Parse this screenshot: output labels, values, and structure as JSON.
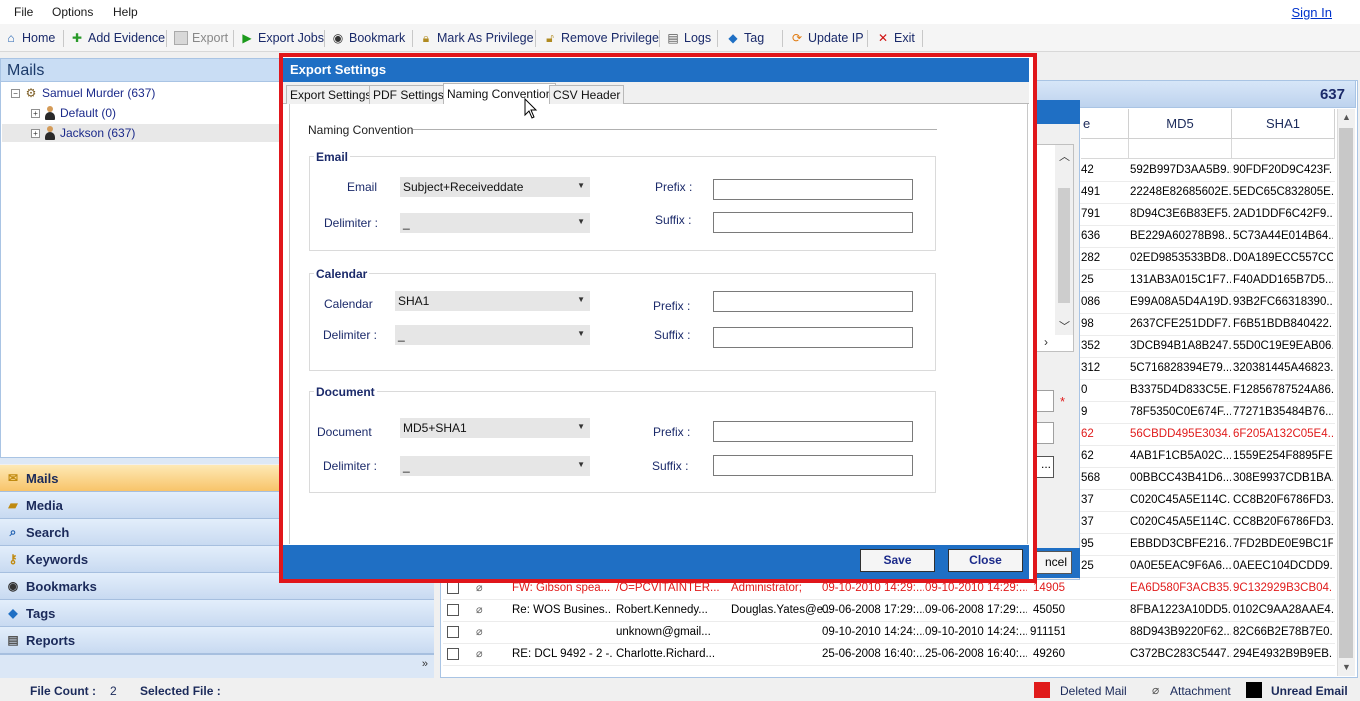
{
  "menubar": {
    "items": [
      "File",
      "Options",
      "Help"
    ],
    "signin": "Sign In"
  },
  "toolbar": {
    "home": "Home",
    "add_evidence": "Add Evidence",
    "export": "Export",
    "export_jobs": "Export Jobs",
    "bookmark": "Bookmark",
    "mark_privilege": "Mark As Privilege",
    "remove_privilege": "Remove Privilege",
    "logs": "Logs",
    "tag": "Tag",
    "update_ip": "Update IP",
    "exit": "Exit"
  },
  "mails_panel": {
    "header": "Mails",
    "tree": [
      {
        "label": "Samuel Murder (637)"
      },
      {
        "label": "Default (0)"
      },
      {
        "label": "Jackson (637)"
      }
    ]
  },
  "nav": [
    "Mails",
    "Media",
    "Search",
    "Keywords",
    "Bookmarks",
    "Tags",
    "Reports"
  ],
  "grid": {
    "count": "637",
    "headers": {
      "size_partial": "e",
      "md5": "MD5",
      "sha1": "SHA1"
    },
    "visible_rows": [
      {
        "size": "42",
        "md5": "592B997D3AA5B9...",
        "sha1": "90FDF20D9C423F...",
        "deleted": false
      },
      {
        "size": "491",
        "md5": "22248E82685602E...",
        "sha1": "5EDC65C832805E...",
        "deleted": false
      },
      {
        "size": "791",
        "md5": "8D94C3E6B83EF5...",
        "sha1": "2AD1DDF6C42F9...",
        "deleted": false
      },
      {
        "size": "636",
        "md5": "BE229A60278B98...",
        "sha1": "5C73A44E014B64...",
        "deleted": false
      },
      {
        "size": "282",
        "md5": "02ED9853533BD8...",
        "sha1": "D0A189ECC557CC...",
        "deleted": false
      },
      {
        "size": "25",
        "md5": "131AB3A015C1F7...",
        "sha1": "F40ADD165B7D5...",
        "deleted": false
      },
      {
        "size": "086",
        "md5": "E99A08A5D4A19D...",
        "sha1": "93B2FC66318390...",
        "deleted": false
      },
      {
        "size": "98",
        "md5": "2637CFE251DDF7...",
        "sha1": "F6B51BDB840422...",
        "deleted": false
      },
      {
        "size": "352",
        "md5": "3DCB94B1A8B247...",
        "sha1": "55D0C19E9EAB06...",
        "deleted": false
      },
      {
        "size": "312",
        "md5": "5C716828394E79...",
        "sha1": "320381445A46823...",
        "deleted": false
      },
      {
        "size": "0",
        "md5": "B3375D4D833C5E...",
        "sha1": "F12856787524A86...",
        "deleted": false
      },
      {
        "size": "9",
        "md5": "78F5350C0E674F...",
        "sha1": "77271B35484B76...",
        "deleted": false
      },
      {
        "size": "62",
        "md5": "56CBDD495E3034...",
        "sha1": "6F205A132C05E4...",
        "deleted": true
      },
      {
        "size": "62",
        "md5": "4AB1F1CB5A02C...",
        "sha1": "1559E254F8895FE...",
        "deleted": false
      },
      {
        "size": "568",
        "md5": "00BBCC43B41D6...",
        "sha1": "308E9937CDB1BA...",
        "deleted": false
      },
      {
        "size": "37",
        "md5": "C020C45A5E114C...",
        "sha1": "CC8B20F6786FD3...",
        "deleted": false
      },
      {
        "size": "37",
        "md5": "C020C45A5E114C...",
        "sha1": "CC8B20F6786FD3...",
        "deleted": false
      },
      {
        "size": "95",
        "md5": "EBBDD3CBFE216...",
        "sha1": "7FD2BDE0E9BC1F...",
        "deleted": false
      },
      {
        "size": "25",
        "md5": "0A0E5EAC9F6A6...",
        "sha1": "0AEEC104DCDD9...",
        "deleted": false
      }
    ],
    "full_rows": [
      {
        "subject": "FW: Gibson spea...",
        "from": "/O=PCVITAINTER...",
        "to": "Administrator;",
        "sent": "09-10-2010 14:29:...",
        "received": "09-10-2010 14:29:...",
        "size": "14905",
        "md5": "EA6D580F3ACB35...",
        "sha1": "9C132929B3CB04...",
        "deleted": true
      },
      {
        "subject": "Re: WOS Busines...",
        "from": "Robert.Kennedy...",
        "to": "Douglas.Yates@e...",
        "sent": "09-06-2008 17:29:...",
        "received": "09-06-2008 17:29:...",
        "size": "45050",
        "md5": "8FBA1223A10DD5...",
        "sha1": "0102C9AA28AAE4...",
        "deleted": false
      },
      {
        "subject": "",
        "from": "unknown@gmail...",
        "to": "",
        "sent": "09-10-2010 14:24:...",
        "received": "09-10-2010 14:24:...",
        "size": "911151",
        "md5": "88D943B9220F62...",
        "sha1": "82C66B2E78B7E0...",
        "deleted": false
      },
      {
        "subject": "RE: DCL 9492 - 2 -...",
        "from": "Charlotte.Richard...",
        "to": "",
        "sent": "25-06-2008 16:40:...",
        "received": "25-06-2008 16:40:...",
        "size": "49260",
        "md5": "C372BC283C5447...",
        "sha1": "294E4932B9B9EB...",
        "deleted": false
      }
    ]
  },
  "bg_dialog": {
    "required_star": "*",
    "browse": "...",
    "cancel_partial": "ncel"
  },
  "export_dialog": {
    "title": "Export Settings",
    "tabs": [
      "Export Settings",
      "PDF Settings",
      "Naming Convention",
      "CSV Header"
    ],
    "active_tab": "Naming Convention",
    "section_title": "Naming Convention",
    "groups": {
      "email": {
        "title": "Email",
        "field_label": "Email",
        "field_value": "Subject+Receiveddate",
        "delimiter_label": "Delimiter :",
        "delimiter_value": "_",
        "prefix_label": "Prefix :",
        "suffix_label": "Suffix :"
      },
      "calendar": {
        "title": "Calendar",
        "field_label": "Calendar",
        "field_value": "SHA1",
        "delimiter_label": "Delimiter :",
        "delimiter_value": "_",
        "prefix_label": "Prefix :",
        "suffix_label": "Suffix :"
      },
      "document": {
        "title": "Document",
        "field_label": "Document",
        "field_value": "MD5+SHA1",
        "delimiter_label": "Delimiter :",
        "delimiter_value": "_",
        "prefix_label": "Prefix :",
        "suffix_label": "Suffix :"
      }
    },
    "save": "Save",
    "close": "Close"
  },
  "statusbar": {
    "file_count_label": "File Count :",
    "file_count": "2",
    "selected_file_label": "Selected File :",
    "legend_deleted": "Deleted Mail",
    "legend_attachment": "Attachment",
    "legend_unread": "Unread Email"
  },
  "colors": {
    "accent_blue": "#1f6fc4",
    "highlight_red": "#e0161b",
    "deleted_red": "#e01b1b"
  },
  "icons": [
    "home-icon",
    "add-evidence-icon",
    "export-icon",
    "export-jobs-icon",
    "bookmark-icon",
    "privilege-icon",
    "logs-icon",
    "tag-icon",
    "update-ip-icon",
    "exit-icon"
  ]
}
